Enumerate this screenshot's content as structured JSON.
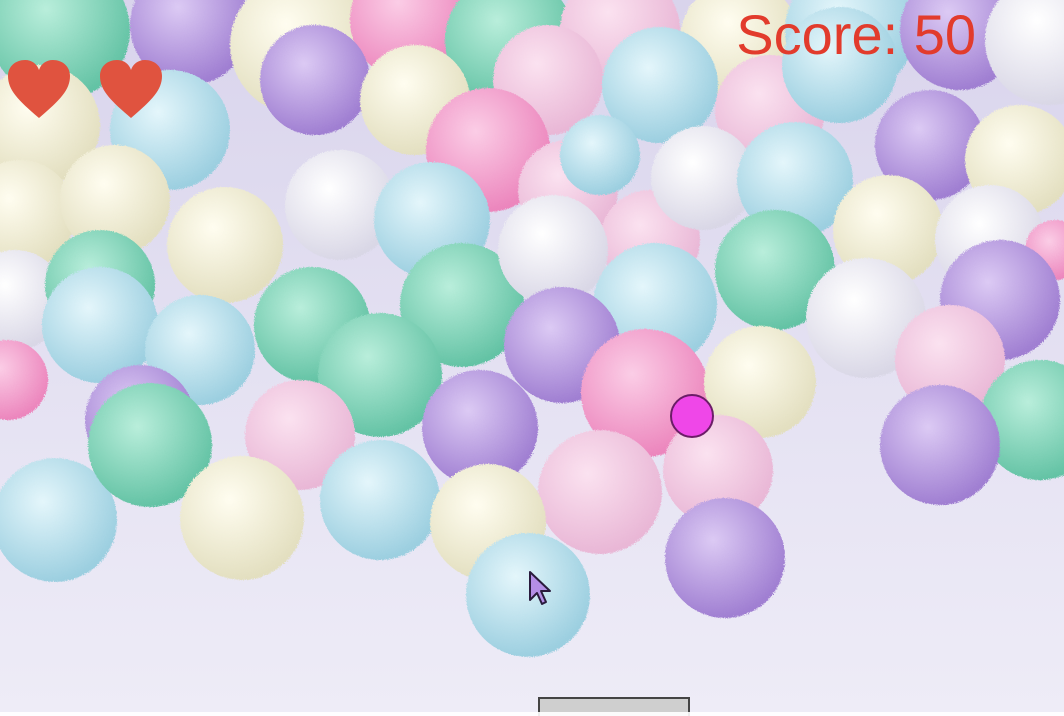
{
  "hud": {
    "score_text": "Score: 50",
    "lives": 2,
    "heart_color": "#e0533f",
    "score_color": "#e23b2c"
  },
  "ball": {
    "color": "#ef47e8",
    "outline": "#6b1d67"
  },
  "paddle": {
    "color": "#cfcfcf"
  },
  "background": {
    "description_colors": [
      "#f4a3cf",
      "#a9dbe6",
      "#7fd3b8",
      "#b89ae0",
      "#f3efd6",
      "#f1eef6"
    ]
  }
}
